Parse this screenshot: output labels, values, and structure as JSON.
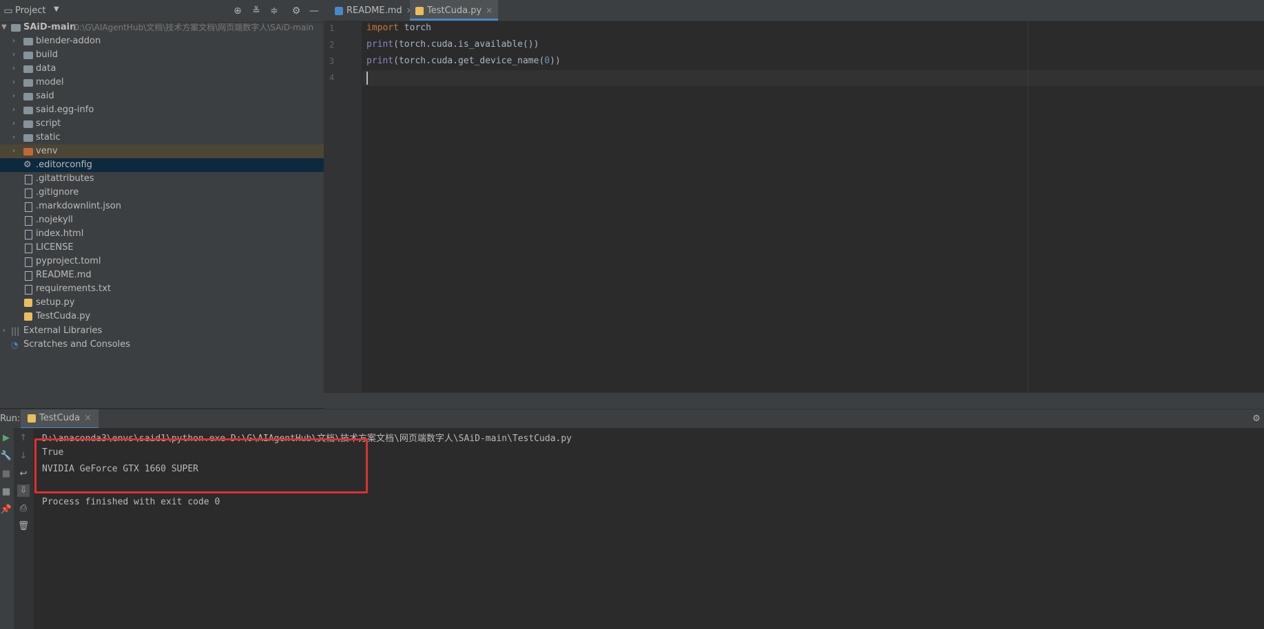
{
  "project_panel": {
    "title": "Project",
    "header_icons": [
      "locate-icon",
      "expand-all-icon",
      "collapse-all-icon",
      "gear-icon",
      "minimize-icon"
    ],
    "root": {
      "name": "SAiD-main",
      "path": "D:\\G\\AIAgentHub\\文档\\技术方案文档\\网页端数字人\\SAiD-main"
    },
    "items": [
      {
        "label": "blender-addon",
        "type": "folder"
      },
      {
        "label": "build",
        "type": "folder"
      },
      {
        "label": "data",
        "type": "folder"
      },
      {
        "label": "model",
        "type": "folder"
      },
      {
        "label": "said",
        "type": "folder"
      },
      {
        "label": "said.egg-info",
        "type": "folder"
      },
      {
        "label": "script",
        "type": "folder"
      },
      {
        "label": "static",
        "type": "folder"
      },
      {
        "label": "venv",
        "type": "folder-excluded"
      },
      {
        "label": ".editorconfig",
        "type": "config"
      },
      {
        "label": ".gitattributes",
        "type": "file"
      },
      {
        "label": ".gitignore",
        "type": "file"
      },
      {
        "label": ".markdownlint.json",
        "type": "file"
      },
      {
        "label": ".nojekyll",
        "type": "file"
      },
      {
        "label": "index.html",
        "type": "file"
      },
      {
        "label": "LICENSE",
        "type": "file"
      },
      {
        "label": "pyproject.toml",
        "type": "file"
      },
      {
        "label": "README.md",
        "type": "file"
      },
      {
        "label": "requirements.txt",
        "type": "file"
      },
      {
        "label": "setup.py",
        "type": "python"
      },
      {
        "label": "TestCuda.py",
        "type": "python"
      }
    ],
    "external_libraries": "External Libraries",
    "scratches": "Scratches and Consoles"
  },
  "editor_tabs": [
    {
      "label": "README.md",
      "close": "×"
    },
    {
      "label": "TestCuda.py",
      "close": "×",
      "active": true
    }
  ],
  "editor": {
    "line_numbers": [
      "1",
      "2",
      "3",
      "4"
    ],
    "lines": [
      {
        "kw": "import",
        "rest": " torch"
      },
      {
        "fn": "print",
        "a": "(torch.cuda.is_available())"
      },
      {
        "fn": "print",
        "a": "(torch.cuda.get_device_name(",
        "num": "0",
        "b": "))"
      },
      {}
    ]
  },
  "run_panel": {
    "label": "Run:",
    "tab": "TestCuda",
    "tab_close": "×",
    "output": [
      "D:\\anaconda3\\envs\\said1\\python.exe D:\\G\\AIAgentHub\\文档\\技术方案文档\\网页端数字人\\SAiD-main\\TestCuda.py",
      "True",
      "NVIDIA GeForce GTX 1660 SUPER",
      "",
      "Process finished with exit code 0"
    ]
  },
  "colors": {
    "highlight_box": "#e03030",
    "accent": "#4a88c7"
  }
}
